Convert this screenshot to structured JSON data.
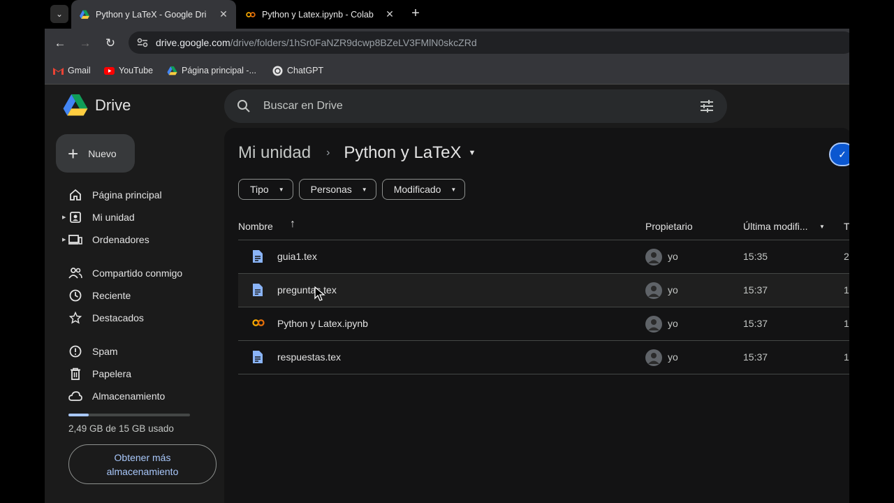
{
  "browser": {
    "tabs": [
      {
        "title": "Python y LaTeX - Google Dri",
        "favicon": "drive-icon",
        "active": true
      },
      {
        "title": "Python y Latex.ipynb - Colab",
        "favicon": "colab-icon",
        "active": false
      }
    ],
    "url_host": "drive.google.com",
    "url_path": "/drive/folders/1hSr0FaNZR9dcwp8BZeLV3FMlN0skcZRd",
    "bookmarks": [
      {
        "label": "Gmail",
        "icon": "gmail-icon"
      },
      {
        "label": "YouTube",
        "icon": "youtube-icon"
      },
      {
        "label": "Página principal -...",
        "icon": "drive-icon"
      },
      {
        "label": "ChatGPT",
        "icon": "chatgpt-icon"
      }
    ]
  },
  "drive": {
    "logo_text": "Drive",
    "search_placeholder": "Buscar en Drive",
    "new_button": "Nuevo",
    "nav": [
      {
        "label": "Página principal",
        "icon": "home-icon",
        "expandable": false
      },
      {
        "label": "Mi unidad",
        "icon": "my-drive-icon",
        "expandable": true
      },
      {
        "label": "Ordenadores",
        "icon": "computers-icon",
        "expandable": true
      },
      {
        "label": "Compartido conmigo",
        "icon": "shared-icon",
        "expandable": false
      },
      {
        "label": "Reciente",
        "icon": "clock-icon",
        "expandable": false
      },
      {
        "label": "Destacados",
        "icon": "star-icon",
        "expandable": false
      },
      {
        "label": "Spam",
        "icon": "spam-icon",
        "expandable": false
      },
      {
        "label": "Papelera",
        "icon": "trash-icon",
        "expandable": false
      },
      {
        "label": "Almacenamiento",
        "icon": "cloud-icon",
        "expandable": false
      }
    ],
    "storage": {
      "used_text": "2,49 GB de 15 GB usado",
      "fraction_used": 0.166
    },
    "get_more_storage": "Obtener más almacenamiento",
    "breadcrumb": {
      "root": "Mi unidad",
      "current": "Python y LaTeX"
    },
    "filters": [
      "Tipo",
      "Personas",
      "Modificado"
    ],
    "columns": {
      "name": "Nombre",
      "owner": "Propietario",
      "modified": "Última modifi...",
      "size": "T"
    },
    "files": [
      {
        "name": "guia1.tex",
        "type": "doc",
        "owner": "yo",
        "modified": "15:35",
        "size": "2"
      },
      {
        "name": "preguntas.tex",
        "type": "doc",
        "owner": "yo",
        "modified": "15:37",
        "size": "1"
      },
      {
        "name": "Python y Latex.ipynb",
        "type": "colab",
        "owner": "yo",
        "modified": "15:37",
        "size": "1"
      },
      {
        "name": "respuestas.tex",
        "type": "doc",
        "owner": "yo",
        "modified": "15:37",
        "size": "1"
      }
    ],
    "colors": {
      "accent": "#a8c7fa",
      "doc_blue": "#8ab4f8",
      "colab_orange": "#f9ab00"
    }
  }
}
